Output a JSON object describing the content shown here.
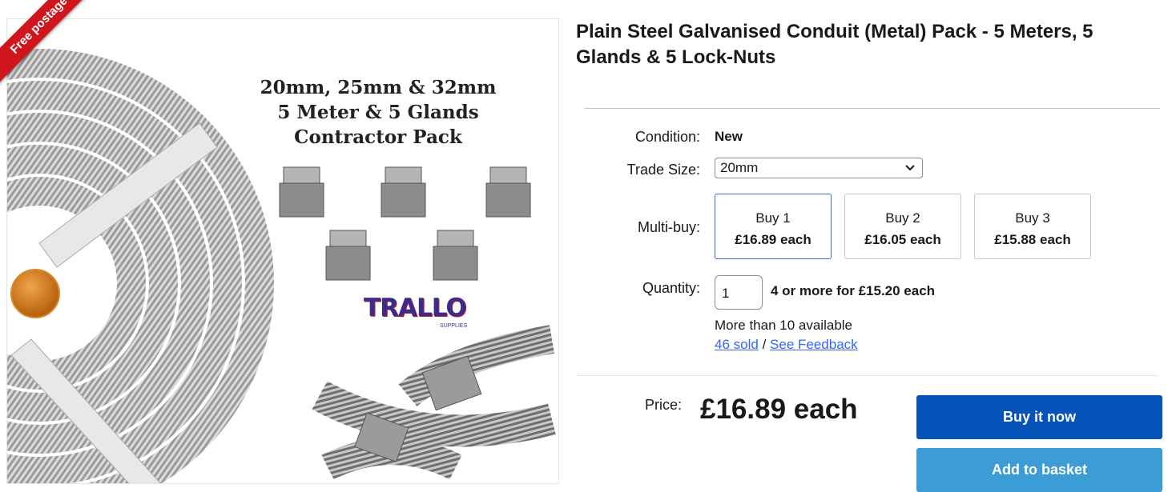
{
  "image": {
    "ribbon": "Free postage",
    "headline": [
      "20mm, 25mm & 32mm",
      "5 Meter & 5 Glands",
      "Contractor Pack"
    ],
    "brand": "TRALLO",
    "brand_sub": "SUPPLIES"
  },
  "title": "Plain Steel Galvanised Conduit (Metal) Pack - 5 Meters, 5 Glands & 5 Lock-Nuts",
  "condition": {
    "label": "Condition:",
    "value": "New"
  },
  "trade_size": {
    "label": "Trade Size:",
    "value": "20mm"
  },
  "multibuy": {
    "label": "Multi-buy:",
    "options": [
      {
        "qty": "Buy 1",
        "price": "£16.89 each"
      },
      {
        "qty": "Buy 2",
        "price": "£16.05 each"
      },
      {
        "qty": "Buy 3",
        "price": "£15.88 each"
      }
    ]
  },
  "quantity": {
    "label": "Quantity:",
    "value": "1",
    "deal": "4 or more for £15.20 each"
  },
  "availability": "More than 10 available",
  "sold_link": "46 sold",
  "separator": "/",
  "feedback_link": "See Feedback",
  "price": {
    "label": "Price:",
    "value": "£16.89 each"
  },
  "buttons": {
    "buy_now": "Buy it now",
    "add_basket": "Add to basket"
  }
}
